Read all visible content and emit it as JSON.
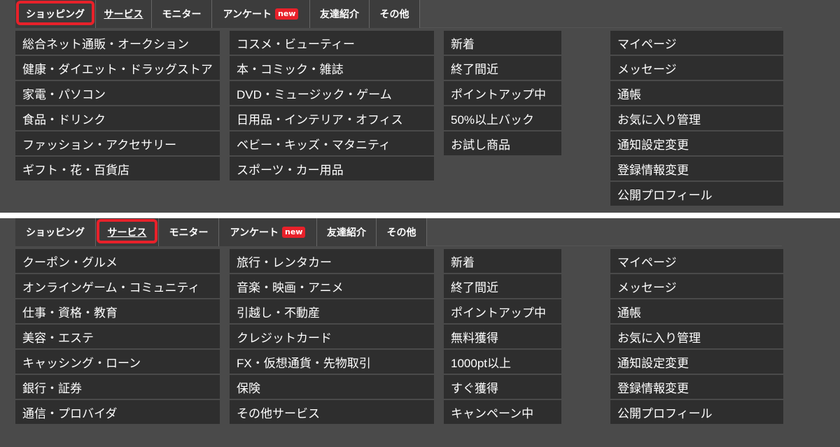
{
  "panels": [
    {
      "tabs": [
        {
          "label": "ショッピング",
          "badge": ""
        },
        {
          "label": "サービス",
          "badge": ""
        },
        {
          "label": "モニター",
          "badge": ""
        },
        {
          "label": "アンケート",
          "badge": "new"
        },
        {
          "label": "友達紹介",
          "badge": ""
        },
        {
          "label": "その他",
          "badge": ""
        }
      ],
      "col1": [
        "総合ネット通販・オークション",
        "健康・ダイエット・ドラッグストア",
        "家電・パソコン",
        "食品・ドリンク",
        "ファッション・アクセサリー",
        "ギフト・花・百貨店"
      ],
      "col2": [
        "コスメ・ビューティー",
        "本・コミック・雑誌",
        "DVD・ミュージック・ゲーム",
        "日用品・インテリア・オフィス",
        "ベビー・キッズ・マタニティ",
        "スポーツ・カー用品"
      ],
      "col3": [
        "新着",
        "終了間近",
        "ポイントアップ中",
        "50%以上バック",
        "お試し商品"
      ],
      "col4": [
        "マイページ",
        "メッセージ",
        "通帳",
        "お気に入り管理",
        "通知設定変更",
        "登録情報変更",
        "公開プロフィール"
      ]
    },
    {
      "tabs": [
        {
          "label": "ショッピング",
          "badge": ""
        },
        {
          "label": "サービス",
          "badge": ""
        },
        {
          "label": "モニター",
          "badge": ""
        },
        {
          "label": "アンケート",
          "badge": "new"
        },
        {
          "label": "友達紹介",
          "badge": ""
        },
        {
          "label": "その他",
          "badge": ""
        }
      ],
      "col1": [
        "クーポン・グルメ",
        "オンラインゲーム・コミュニティ",
        "仕事・資格・教育",
        "美容・エステ",
        "キャッシング・ローン",
        "銀行・証券",
        "通信・プロバイダ"
      ],
      "col2": [
        "旅行・レンタカー",
        "音楽・映画・アニメ",
        "引越し・不動産",
        "クレジットカード",
        "FX・仮想通貨・先物取引",
        "保険",
        "その他サービス"
      ],
      "col3": [
        "新着",
        "終了間近",
        "ポイントアップ中",
        "無料獲得",
        "1000pt以上",
        "すぐ獲得",
        "キャンペーン中"
      ],
      "col4": [
        "マイページ",
        "メッセージ",
        "通帳",
        "お気に入り管理",
        "通知設定変更",
        "登録情報変更",
        "公開プロフィール"
      ]
    }
  ],
  "colors": {
    "panel_bg": "#4a4a4a",
    "item_bg": "#2e2e2e",
    "highlight": "#e8212a"
  }
}
